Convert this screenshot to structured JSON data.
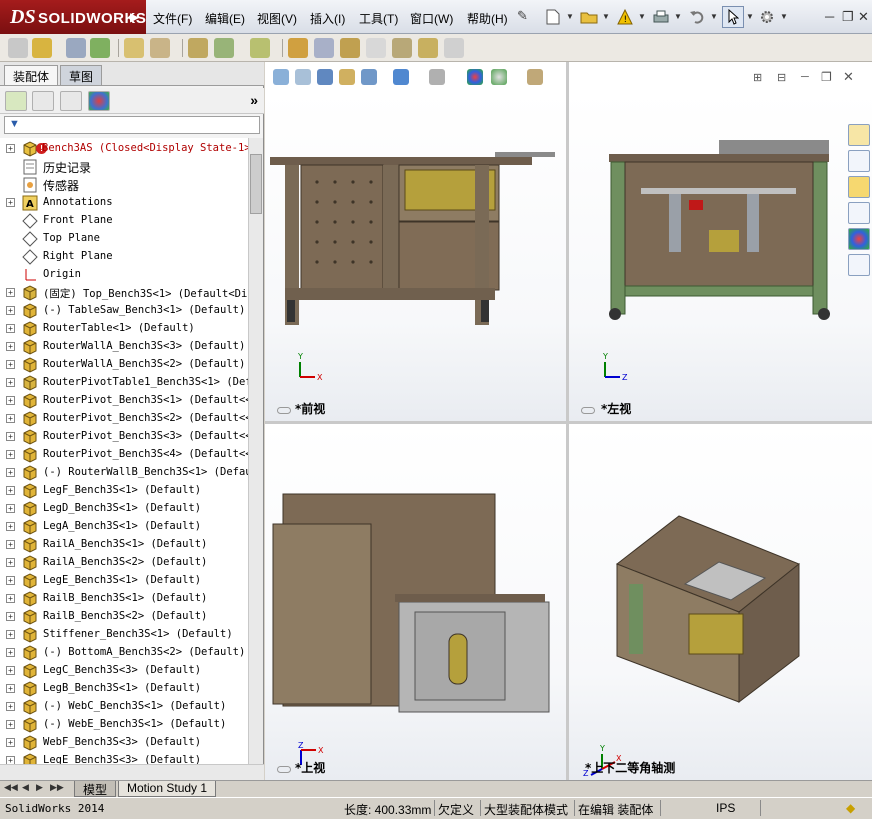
{
  "app": {
    "brand_prefix": "DS",
    "brand_name": "SOLIDWORKS"
  },
  "menu": {
    "items": [
      "文件(F)",
      "编辑(E)",
      "视图(V)",
      "插入(I)",
      "工具(T)",
      "窗口(W)",
      "帮助(H)"
    ]
  },
  "left_panel": {
    "tabs": [
      "装配体",
      "草图"
    ],
    "active_tab": "装配体",
    "collapse_glyph": "»",
    "filter_glyph": "▼"
  },
  "tree": {
    "items": [
      {
        "label": "Bench3AS  (Closed<Display State-1>",
        "icon": "assembly-root-icon",
        "expandable": true,
        "red": true
      },
      {
        "label": "历史记录",
        "icon": "history-icon",
        "expandable": false
      },
      {
        "label": "传感器",
        "icon": "sensor-icon",
        "expandable": false
      },
      {
        "label": "Annotations",
        "icon": "annotations-icon",
        "expandable": true
      },
      {
        "label": "Front Plane",
        "icon": "plane-icon",
        "expandable": false
      },
      {
        "label": "Top Plane",
        "icon": "plane-icon",
        "expandable": false
      },
      {
        "label": "Right Plane",
        "icon": "plane-icon",
        "expandable": false
      },
      {
        "label": "Origin",
        "icon": "origin-icon",
        "expandable": false
      },
      {
        "label": "(固定) Top_Bench3S<1> (Default<Dis",
        "icon": "part-icon",
        "expandable": true
      },
      {
        "label": "(-) TableSaw_Bench3<1> (Default)",
        "icon": "subassembly-icon",
        "expandable": true
      },
      {
        "label": "RouterTable<1> (Default)",
        "icon": "subassembly-icon",
        "expandable": true
      },
      {
        "label": "RouterWallA_Bench3S<3> (Default)",
        "icon": "subassembly-icon",
        "expandable": true
      },
      {
        "label": "RouterWallA_Bench3S<2> (Default)",
        "icon": "subassembly-icon",
        "expandable": true
      },
      {
        "label": "RouterPivotTable1_Bench3S<1> (Defa",
        "icon": "part-icon",
        "expandable": true
      },
      {
        "label": "RouterPivot_Bench3S<1> (Default<<D",
        "icon": "subassembly-icon",
        "expandable": true
      },
      {
        "label": "RouterPivot_Bench3S<2> (Default<<D",
        "icon": "subassembly-icon",
        "expandable": true
      },
      {
        "label": "RouterPivot_Bench3S<3> (Default<<D",
        "icon": "subassembly-icon",
        "expandable": true
      },
      {
        "label": "RouterPivot_Bench3S<4> (Default<<D",
        "icon": "subassembly-icon",
        "expandable": true
      },
      {
        "label": "(-) RouterWallB_Bench3S<1> (Defaul",
        "icon": "subassembly-icon",
        "expandable": true
      },
      {
        "label": "LegF_Bench3S<1> (Default)",
        "icon": "subassembly-icon",
        "expandable": true
      },
      {
        "label": "LegD_Bench3S<1> (Default)",
        "icon": "subassembly-icon",
        "expandable": true
      },
      {
        "label": "LegA_Bench3S<1> (Default)",
        "icon": "subassembly-icon",
        "expandable": true
      },
      {
        "label": "RailA_Bench3S<1> (Default)",
        "icon": "subassembly-icon",
        "expandable": true
      },
      {
        "label": "RailA_Bench3S<2> (Default)",
        "icon": "subassembly-icon",
        "expandable": true
      },
      {
        "label": "LegE_Bench3S<1> (Default)",
        "icon": "subassembly-icon",
        "expandable": true
      },
      {
        "label": "RailB_Bench3S<1> (Default)",
        "icon": "subassembly-icon",
        "expandable": true
      },
      {
        "label": "RailB_Bench3S<2> (Default)",
        "icon": "subassembly-icon",
        "expandable": true
      },
      {
        "label": "Stiffener_Bench3S<1> (Default)",
        "icon": "subassembly-icon",
        "expandable": true
      },
      {
        "label": "(-) BottomA_Bench3S<2> (Default)",
        "icon": "subassembly-icon",
        "expandable": true
      },
      {
        "label": "LegC_Bench3S<3> (Default)",
        "icon": "subassembly-icon",
        "expandable": true
      },
      {
        "label": "LegB_Bench3S<1> (Default)",
        "icon": "subassembly-icon",
        "expandable": true
      },
      {
        "label": "(-) WebC_Bench3S<1> (Default)",
        "icon": "subassembly-icon",
        "expandable": true
      },
      {
        "label": "(-) WebE_Bench3S<1> (Default)",
        "icon": "subassembly-icon",
        "expandable": true
      },
      {
        "label": "WebF_Bench3S<3> (Default)",
        "icon": "subassembly-icon",
        "expandable": true
      },
      {
        "label": "LegE_Bench3S<3> (Default)",
        "icon": "subassembly-icon",
        "expandable": true
      }
    ]
  },
  "viewports": {
    "front": {
      "label": "*前视"
    },
    "left": {
      "label": "*左视"
    },
    "top": {
      "label": "*上视"
    },
    "iso": {
      "label": "*上下二等角轴测"
    }
  },
  "bottom_tabs": [
    "模型",
    "Motion Study 1"
  ],
  "status": {
    "app_version": "SolidWorks 2014",
    "length": "长度: 400.33mm",
    "underdefined": "欠定义",
    "large_assembly": "大型装配体模式",
    "editing": "在编辑 装配体",
    "units": "IPS"
  },
  "colors": {
    "brand_red": "#9a1a1a",
    "wood": "#7d6a55",
    "frame_green": "#6f8f5f",
    "axis_x": "#d00000",
    "axis_y": "#008000",
    "axis_z": "#0000d0"
  }
}
